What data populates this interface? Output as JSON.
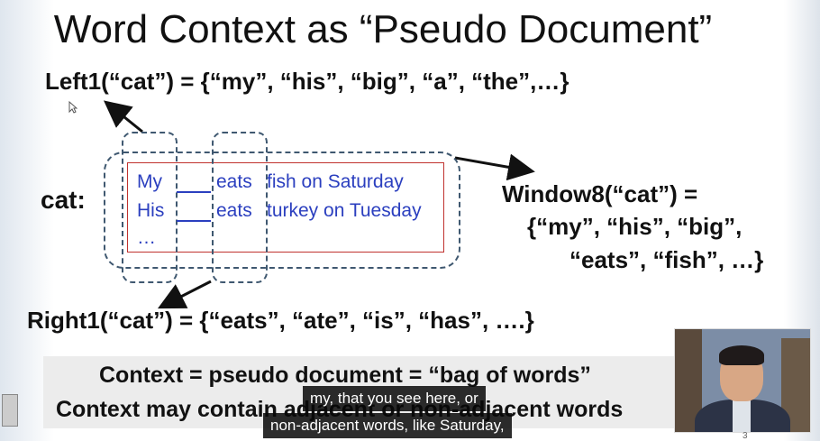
{
  "slide": {
    "title": "Word Context as “Pseudo Document”",
    "left1": "Left1(“cat”) = {“my”, “his”, “big”, “a”, “the”,…}",
    "right1": "Right1(“cat”) = {“eats”, “ate”, “is”, “has”, ….}",
    "cat_label": "cat:",
    "window": {
      "line1": "Window8(“cat”)  =",
      "line2": "{“my”, “his”, “big”,",
      "line3": "“eats”,  “fish”, …}"
    },
    "sentences": {
      "s1_word": "My",
      "s1_rest1": "eats",
      "s1_rest2": "fish on Saturday",
      "s2_word": "His",
      "s2_rest1": "eats",
      "s2_rest2": "turkey on Tuesday",
      "ellipsis": "…"
    },
    "context_line1": "Context = pseudo document = “bag of words”",
    "context_line2": "Context may contain adjacent or non-adjacent words",
    "page_number": "3"
  },
  "captions": {
    "line1": "my, that you see here, or",
    "line2": "non-adjacent words, like Saturday,"
  },
  "colors": {
    "accent_blue": "#2b3fbf",
    "box_red": "#c0322f",
    "dashed": "#3f5870"
  }
}
